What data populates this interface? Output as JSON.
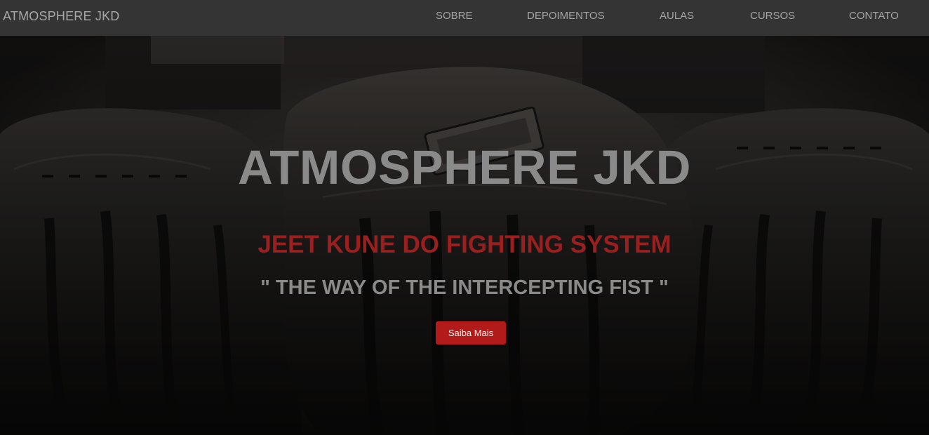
{
  "navbar": {
    "brand": "ATMOSPHERE JKD",
    "links": [
      {
        "label": "SOBRE"
      },
      {
        "label": "DEPOIMENTOS"
      },
      {
        "label": "AULAS"
      },
      {
        "label": "CURSOS"
      },
      {
        "label": "CONTATO"
      }
    ]
  },
  "hero": {
    "background_image": "boxing-gloves-photo",
    "title": "ATMOSPHERE JKD",
    "subtitle": "JEET KUNE DO FIGHTING SYSTEM",
    "quote": "\" THE WAY OF THE INTERCEPTING FIST \"",
    "cta_label": "Saiba Mais"
  },
  "colors": {
    "navbar_bg": "#343434",
    "accent_red": "#b31b1b",
    "subtitle_red": "#9a1f1f",
    "title_gray": "#8a8a8a"
  }
}
